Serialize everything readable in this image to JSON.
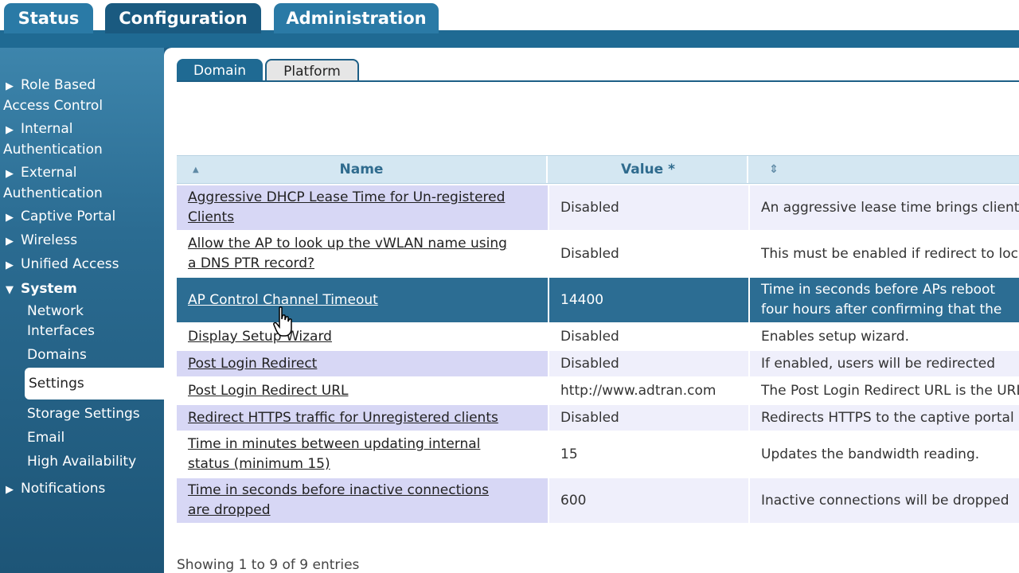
{
  "top_tabs": [
    {
      "label": "Status"
    },
    {
      "label": "Configuration"
    },
    {
      "label": "Administration"
    }
  ],
  "sidebar": {
    "items": [
      {
        "label_line1": "Role Based",
        "label_line2": "Access Control"
      },
      {
        "label_line1": "Internal",
        "label_line2": "Authentication"
      },
      {
        "label_line1": "External",
        "label_line2": "Authentication"
      },
      {
        "label_line1": "Captive Portal"
      },
      {
        "label_line1": "Wireless"
      },
      {
        "label_line1": "Unified Access"
      },
      {
        "label_line1": "System"
      },
      {
        "label_line1": "Notifications"
      }
    ],
    "system_children": [
      {
        "label_line1": "Network",
        "label_line2": "Interfaces"
      },
      {
        "label_line1": "Domains"
      },
      {
        "label_line1": "Settings"
      },
      {
        "label_line1": "Storage Settings"
      },
      {
        "label_line1": "Email"
      },
      {
        "label_line1": "High Availability"
      }
    ],
    "arrow_collapsed": "▶",
    "arrow_expanded": "▼"
  },
  "sub_tabs": [
    {
      "label": "Domain"
    },
    {
      "label": "Platform"
    }
  ],
  "table": {
    "columns": [
      {
        "label": "Name",
        "sort_icon": "▲"
      },
      {
        "label": "Value *"
      },
      {
        "label": "",
        "sort_icon": "⇕"
      }
    ],
    "rows": [
      {
        "name_line1": "Aggressive DHCP Lease Time for Un-registered",
        "name_line2": "Clients",
        "value": "Disabled",
        "desc_line1": "An aggressive lease time brings clients"
      },
      {
        "name_line1": "Allow the AP to look up the vWLAN name using",
        "name_line2": "a DNS PTR record?",
        "value": "Disabled",
        "desc_line1": "This must be enabled if redirect to location"
      },
      {
        "name_line1": "AP Control Channel Timeout",
        "value": "14400",
        "desc_line1": "Time in seconds before APs reboot",
        "desc_line2": "four hours after confirming that the"
      },
      {
        "name_line1": "Display Setup Wizard",
        "value": "Disabled",
        "desc_line1": "Enables setup wizard."
      },
      {
        "name_line1": "Post Login Redirect",
        "value": "Disabled",
        "desc_line1": "If enabled, users will be redirected"
      },
      {
        "name_line1": "Post Login Redirect URL",
        "value": "http://www.adtran.com",
        "desc_line1": "The Post Login Redirect URL is the URL"
      },
      {
        "name_line1": "Redirect HTTPS traffic for Unregistered clients",
        "value": "Disabled",
        "desc_line1": "Redirects HTTPS to the captive portal"
      },
      {
        "name_line1": "Time in minutes between updating internal",
        "name_line2": "status (minimum 15)",
        "value": "15",
        "desc_line1": "Updates the bandwidth reading."
      },
      {
        "name_line1": "Time in seconds before inactive connections",
        "name_line2": "are dropped",
        "value": "600",
        "desc_line1": "Inactive connections will be dropped"
      }
    ]
  },
  "footer": {
    "entries_text": "Showing 1 to 9 of 9 entries"
  }
}
